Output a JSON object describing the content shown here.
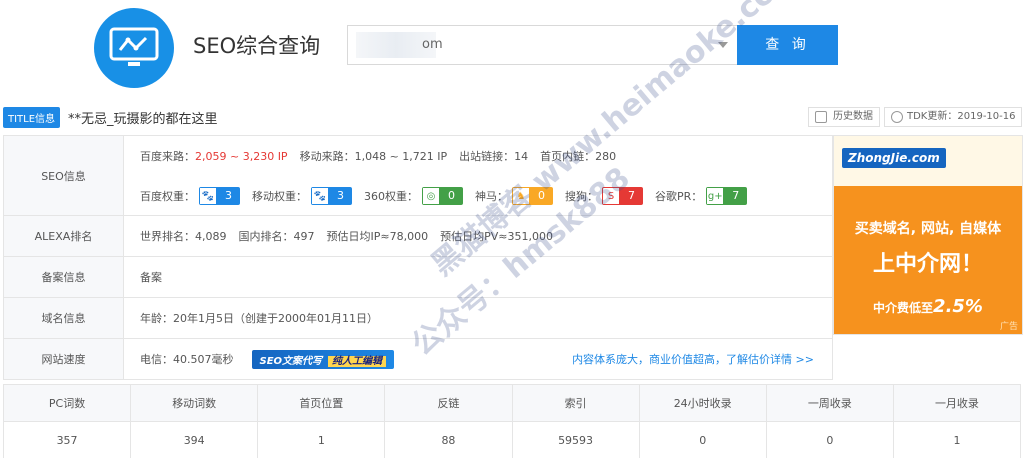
{
  "header": {
    "site_title": "SEO综合查询",
    "search_value": "om",
    "search_button": "查 询"
  },
  "title_row": {
    "tag": "TITLE信息",
    "text": "**无忌_玩摄影的都在这里",
    "history_button": "历史数据",
    "tdk_update": "TDK更新：2019-10-16"
  },
  "info": {
    "seo_label": "SEO信息",
    "baidu_source_label": "百度来路：",
    "baidu_source_value": "2,059 ~ 3,230 IP",
    "mobile_source_label": "移动来路：",
    "mobile_source_value": "1,048 ~ 1,721 IP",
    "outlinks_label": "出站链接：",
    "outlinks_value": "14",
    "homepage_inlinks_label": "首页内链：",
    "homepage_inlinks_value": "280",
    "baidu_weight_label": "百度权重：",
    "baidu_weight_value": "3",
    "mobile_weight_label": "移动权重：",
    "mobile_weight_value": "3",
    "weight_360_label": "360权重：",
    "weight_360_value": "0",
    "shenma_label": "神马：",
    "shenma_value": "0",
    "sogou_label": "搜狗：",
    "sogou_value": "7",
    "google_pr_label": "谷歌PR：",
    "google_pr_value": "7",
    "alexa_label": "ALEXA排名",
    "world_rank_label": "世界排名：",
    "world_rank_value": "4,089",
    "domestic_rank_label": "国内排名：",
    "domestic_rank_value": "497",
    "daily_ip_label": "预估日均IP≈",
    "daily_ip_value": "78,000",
    "daily_pv_label": "预估日均PV≈",
    "daily_pv_value": "351,000",
    "icp_label": "备案信息",
    "icp_text": "备案",
    "domain_label": "域名信息",
    "age_label": "年龄：",
    "age_value": "20年1月5日（创建于2000年01月11日）",
    "speed_label": "网站速度",
    "telecom_label": "电信：",
    "telecom_value": "40.507毫秒",
    "promo_badge": "SEO文案代写",
    "promo_badge_highlight": "纯人工编辑",
    "promo_link": "内容体系庞大，商业价值超高，了解估价详情 >>"
  },
  "ad": {
    "brand": "ZhongJie.com",
    "line1": "买卖域名, 网站, 自媒体",
    "line2": "上中介网！",
    "line3_prefix": "中介费低至",
    "line3_value": "2.5%",
    "ad_tag": "广告"
  },
  "stats": {
    "headers": [
      "PC词数",
      "移动词数",
      "首页位置",
      "反链",
      "索引",
      "24小时收录",
      "一周收录",
      "一月收录"
    ],
    "values": [
      "357",
      "394",
      "1",
      "88",
      "59593",
      "0",
      "0",
      "1"
    ]
  },
  "watermark": {
    "text1": "黑猫博客 www.heimaoke.com",
    "text2": "公众号：hmsk888"
  },
  "colors": {
    "accent": "#1e88e5",
    "red_value": "#e53935",
    "ad_orange": "#f6921e",
    "badge_blue": "#1e88e5",
    "badge_green": "#43a047",
    "badge_orange": "#f9a825",
    "badge_red": "#e53935"
  }
}
